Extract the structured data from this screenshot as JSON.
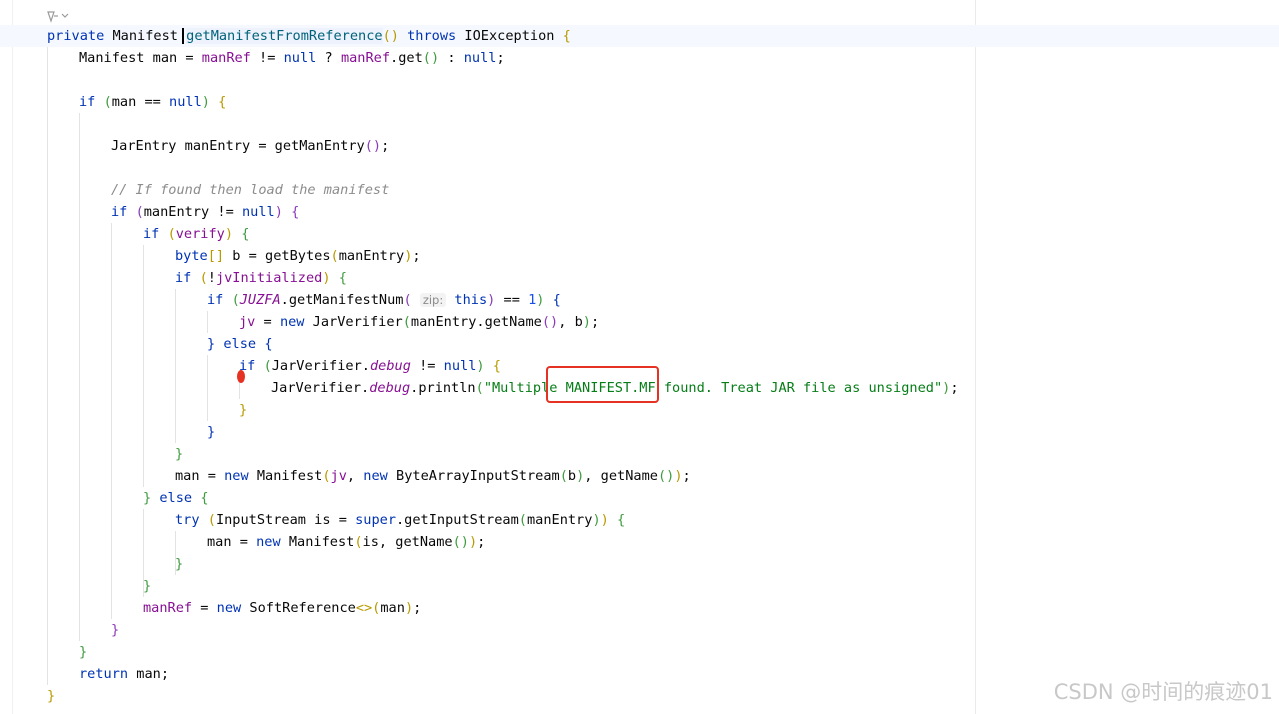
{
  "editor": {
    "watermark": "CSDN @时间的痕迹01",
    "hint_label": "zip:",
    "code": {
      "l1_kw1": "private",
      "l1_t1": " Manifest ",
      "l1_fn": "getManifestFromReference",
      "l1_p1": "()",
      "l1_sp": " ",
      "l1_kw2": "throws",
      "l1_t2": " IOException ",
      "l1_br": "{",
      "l2_t1": "Manifest man = ",
      "l2_f1": "manRef",
      "l2_t2": " != ",
      "l2_k1": "null",
      "l2_t3": " ? ",
      "l2_f2": "manRef",
      "l2_t4": ".get",
      "l2_p": "()",
      "l2_t5": " : ",
      "l2_k2": "null",
      "l2_t6": ";",
      "l3_kw": "if",
      "l3_sp": " ",
      "l3_p1": "(",
      "l3_t1": "man == ",
      "l3_k": "null",
      "l3_p2": ")",
      "l3_sp2": " ",
      "l3_br": "{",
      "l4_t1": "JarEntry manEntry = getManEntry",
      "l4_p": "()",
      "l4_t2": ";",
      "l5_cm": "// If found then load the manifest",
      "l6_kw": "if",
      "l6_sp": " ",
      "l6_p1": "(",
      "l6_t1": "manEntry != ",
      "l6_k": "null",
      "l6_p2": ")",
      "l6_sp2": " ",
      "l6_br": "{",
      "l7_kw": "if",
      "l7_sp": " ",
      "l7_p1": "(",
      "l7_t1": "verify",
      "l7_p2": ")",
      "l7_sp2": " ",
      "l7_br": "{",
      "l8_kw": "byte",
      "l8_b": "[]",
      "l8_t1": " b = getBytes",
      "l8_p1": "(",
      "l8_t2": "manEntry",
      "l8_p2": ")",
      "l8_t3": ";",
      "l9_kw": "if",
      "l9_sp": " ",
      "l9_p1": "(",
      "l9_t1": "!",
      "l9_f": "jvInitialized",
      "l9_p2": ")",
      "l9_sp2": " ",
      "l9_br": "{",
      "l10_kw": "if",
      "l10_sp": " ",
      "l10_p1": "(",
      "l10_st": "JUZFA",
      "l10_t1": ".getManifestNum",
      "l10_p2": "(",
      "l10_sp3": " ",
      "l10_k": "this",
      "l10_p3": ")",
      "l10_t2": " == ",
      "l10_n": "1",
      "l10_p4": ")",
      "l10_sp2": " ",
      "l10_br": "{",
      "l11_f": "jv",
      "l11_t1": " = ",
      "l11_k": "new",
      "l11_t2": " JarVerifier",
      "l11_p1": "(",
      "l11_t3": "manEntry.getName",
      "l11_p2": "()",
      "l11_t4": ", b",
      "l11_p3": ")",
      "l11_t5": ";",
      "l12_br1": "}",
      "l12_sp": " ",
      "l12_k": "else",
      "l12_sp2": " ",
      "l12_br2": "{",
      "l13_kw": "if",
      "l13_sp": " ",
      "l13_p1": "(",
      "l13_t1": "JarVerifier.",
      "l13_st": "debug",
      "l13_t2": " != ",
      "l13_k": "null",
      "l13_p2": ")",
      "l13_sp2": " ",
      "l13_br": "{",
      "l14_t1": "JarVerifier.",
      "l14_st": "debug",
      "l14_t2": ".println",
      "l14_p1": "(",
      "l14_s": "\"Multiple MANIFEST.MF found. Treat JAR file as unsigned\"",
      "l14_p2": ")",
      "l14_t3": ";",
      "l15_br": "}",
      "l16_br": "}",
      "l17_br": "}",
      "l18_t1": "man = ",
      "l18_k1": "new",
      "l18_t2": " Manifest",
      "l18_p1": "(",
      "l18_f": "jv",
      "l18_t3": ", ",
      "l18_k2": "new",
      "l18_t4": " ByteArrayInputStream",
      "l18_p2": "(",
      "l18_t5": "b",
      "l18_p3": ")",
      "l18_t6": ", getName",
      "l18_p4": "()",
      "l18_p5": ")",
      "l18_t7": ";",
      "l19_br1": "}",
      "l19_sp": " ",
      "l19_k": "else",
      "l19_sp2": " ",
      "l19_br2": "{",
      "l20_k1": "try",
      "l20_sp": " ",
      "l20_p1": "(",
      "l20_t1": "InputStream is = ",
      "l20_k2": "super",
      "l20_t2": ".getInputStream",
      "l20_p2": "(",
      "l20_t3": "manEntry",
      "l20_p3": ")",
      "l20_p4": ")",
      "l20_sp2": " ",
      "l20_br": "{",
      "l21_t1": "man = ",
      "l21_k": "new",
      "l21_t2": " Manifest",
      "l21_p1": "(",
      "l21_t3": "is, getName",
      "l21_p2": "()",
      "l21_p3": ")",
      "l21_t4": ";",
      "l22_br": "}",
      "l23_br": "}",
      "l24_f": "manRef",
      "l24_t1": " = ",
      "l24_k": "new",
      "l24_t2": " SoftReference",
      "l24_p1": "<>(",
      "l24_t3": "man",
      "l24_p2": ")",
      "l24_t4": ";",
      "l25_br": "}",
      "l26_br": "}",
      "l27_k": "return",
      "l27_t1": " man;",
      "l28_br": "}"
    }
  }
}
